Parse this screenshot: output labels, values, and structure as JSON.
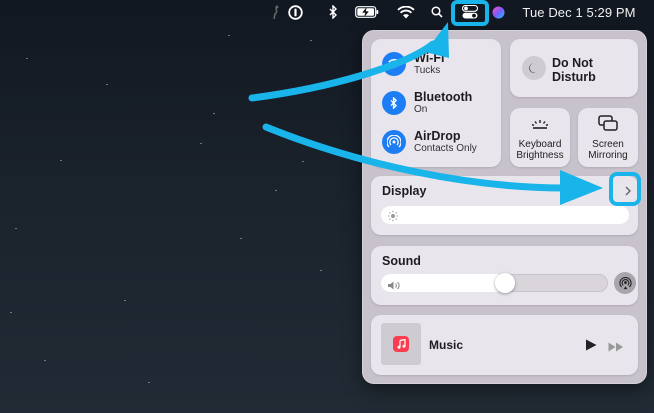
{
  "menubar": {
    "clock": "Tue Dec 1  5:29 PM",
    "icons": [
      "script-icon",
      "onepassword-icon",
      "bluetooth-icon",
      "battery-charging-icon",
      "wifi-icon",
      "search-icon",
      "control-center-icon",
      "siri-icon"
    ]
  },
  "control_center": {
    "wifi": {
      "title": "Wi-Fi",
      "subtitle": "Tucks"
    },
    "bluetooth": {
      "title": "Bluetooth",
      "subtitle": "On"
    },
    "airdrop": {
      "title": "AirDrop",
      "subtitle": "Contacts Only"
    },
    "do_not_disturb": {
      "line1": "Do Not",
      "line2": "Disturb"
    },
    "keyboard_brightness": {
      "line1": "Keyboard",
      "line2": "Brightness"
    },
    "screen_mirroring": {
      "line1": "Screen",
      "line2": "Mirroring"
    },
    "display": {
      "title": "Display",
      "level": 1.0
    },
    "sound": {
      "title": "Sound",
      "level": 0.5
    },
    "music": {
      "title": "Music"
    }
  },
  "colors": {
    "accent_blue": "#1d7df5",
    "annotation_cyan": "#18b4ea",
    "music_red": "#fa3e4f"
  }
}
